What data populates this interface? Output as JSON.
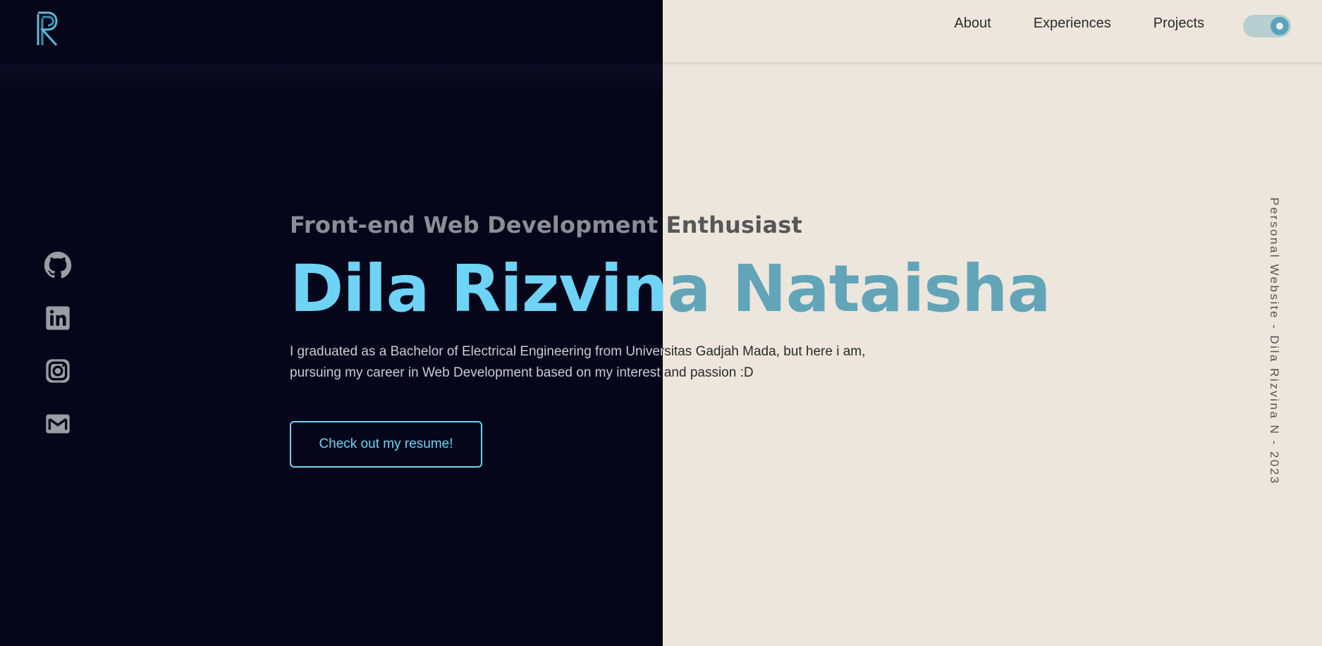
{
  "header": {
    "logo_icon": "r-monogram-logo",
    "nav": [
      {
        "label": "About"
      },
      {
        "label": "Experiences"
      },
      {
        "label": "Projects"
      }
    ],
    "theme_toggle": {
      "icon": "toggle-switch",
      "state": "on"
    }
  },
  "social": [
    {
      "icon": "github-icon"
    },
    {
      "icon": "linkedin-icon"
    },
    {
      "icon": "instagram-icon"
    },
    {
      "icon": "mail-icon"
    }
  ],
  "hero": {
    "subtitle": "Front-end Web Development Enthusiast",
    "name": "Dila Rizvina Nataisha",
    "description_line1": "I graduated as a Bachelor of Electrical Engineering from Universitas Gadjah Mada, but here i am,",
    "description_line2": "pursuing my career in Web Development based on my interest and passion :D",
    "cta_label": "Check out my resume!"
  },
  "side_text": "Personal Website - Dila Rizvina N - 2023",
  "colors": {
    "dark_bg": "#06061a",
    "light_bg": "#ede6dc",
    "accent_bright": "#6fd3f5",
    "accent_muted": "#62a5b9"
  }
}
